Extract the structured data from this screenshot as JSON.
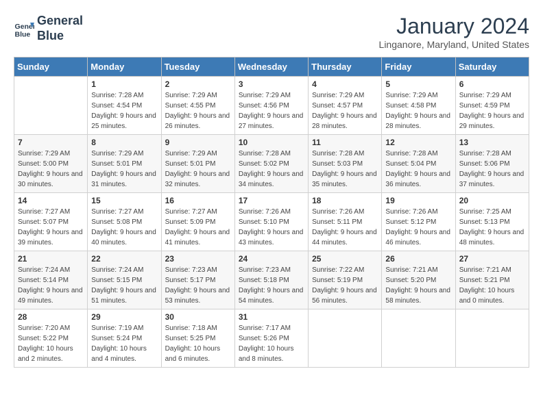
{
  "header": {
    "logo_line1": "General",
    "logo_line2": "Blue",
    "title": "January 2024",
    "subtitle": "Linganore, Maryland, United States"
  },
  "days_of_week": [
    "Sunday",
    "Monday",
    "Tuesday",
    "Wednesday",
    "Thursday",
    "Friday",
    "Saturday"
  ],
  "weeks": [
    [
      {
        "day": "",
        "sunrise": "",
        "sunset": "",
        "daylight": ""
      },
      {
        "day": "1",
        "sunrise": "Sunrise: 7:28 AM",
        "sunset": "Sunset: 4:54 PM",
        "daylight": "Daylight: 9 hours and 25 minutes."
      },
      {
        "day": "2",
        "sunrise": "Sunrise: 7:29 AM",
        "sunset": "Sunset: 4:55 PM",
        "daylight": "Daylight: 9 hours and 26 minutes."
      },
      {
        "day": "3",
        "sunrise": "Sunrise: 7:29 AM",
        "sunset": "Sunset: 4:56 PM",
        "daylight": "Daylight: 9 hours and 27 minutes."
      },
      {
        "day": "4",
        "sunrise": "Sunrise: 7:29 AM",
        "sunset": "Sunset: 4:57 PM",
        "daylight": "Daylight: 9 hours and 28 minutes."
      },
      {
        "day": "5",
        "sunrise": "Sunrise: 7:29 AM",
        "sunset": "Sunset: 4:58 PM",
        "daylight": "Daylight: 9 hours and 28 minutes."
      },
      {
        "day": "6",
        "sunrise": "Sunrise: 7:29 AM",
        "sunset": "Sunset: 4:59 PM",
        "daylight": "Daylight: 9 hours and 29 minutes."
      }
    ],
    [
      {
        "day": "7",
        "sunrise": "Sunrise: 7:29 AM",
        "sunset": "Sunset: 5:00 PM",
        "daylight": "Daylight: 9 hours and 30 minutes."
      },
      {
        "day": "8",
        "sunrise": "Sunrise: 7:29 AM",
        "sunset": "Sunset: 5:01 PM",
        "daylight": "Daylight: 9 hours and 31 minutes."
      },
      {
        "day": "9",
        "sunrise": "Sunrise: 7:29 AM",
        "sunset": "Sunset: 5:01 PM",
        "daylight": "Daylight: 9 hours and 32 minutes."
      },
      {
        "day": "10",
        "sunrise": "Sunrise: 7:28 AM",
        "sunset": "Sunset: 5:02 PM",
        "daylight": "Daylight: 9 hours and 34 minutes."
      },
      {
        "day": "11",
        "sunrise": "Sunrise: 7:28 AM",
        "sunset": "Sunset: 5:03 PM",
        "daylight": "Daylight: 9 hours and 35 minutes."
      },
      {
        "day": "12",
        "sunrise": "Sunrise: 7:28 AM",
        "sunset": "Sunset: 5:04 PM",
        "daylight": "Daylight: 9 hours and 36 minutes."
      },
      {
        "day": "13",
        "sunrise": "Sunrise: 7:28 AM",
        "sunset": "Sunset: 5:06 PM",
        "daylight": "Daylight: 9 hours and 37 minutes."
      }
    ],
    [
      {
        "day": "14",
        "sunrise": "Sunrise: 7:27 AM",
        "sunset": "Sunset: 5:07 PM",
        "daylight": "Daylight: 9 hours and 39 minutes."
      },
      {
        "day": "15",
        "sunrise": "Sunrise: 7:27 AM",
        "sunset": "Sunset: 5:08 PM",
        "daylight": "Daylight: 9 hours and 40 minutes."
      },
      {
        "day": "16",
        "sunrise": "Sunrise: 7:27 AM",
        "sunset": "Sunset: 5:09 PM",
        "daylight": "Daylight: 9 hours and 41 minutes."
      },
      {
        "day": "17",
        "sunrise": "Sunrise: 7:26 AM",
        "sunset": "Sunset: 5:10 PM",
        "daylight": "Daylight: 9 hours and 43 minutes."
      },
      {
        "day": "18",
        "sunrise": "Sunrise: 7:26 AM",
        "sunset": "Sunset: 5:11 PM",
        "daylight": "Daylight: 9 hours and 44 minutes."
      },
      {
        "day": "19",
        "sunrise": "Sunrise: 7:26 AM",
        "sunset": "Sunset: 5:12 PM",
        "daylight": "Daylight: 9 hours and 46 minutes."
      },
      {
        "day": "20",
        "sunrise": "Sunrise: 7:25 AM",
        "sunset": "Sunset: 5:13 PM",
        "daylight": "Daylight: 9 hours and 48 minutes."
      }
    ],
    [
      {
        "day": "21",
        "sunrise": "Sunrise: 7:24 AM",
        "sunset": "Sunset: 5:14 PM",
        "daylight": "Daylight: 9 hours and 49 minutes."
      },
      {
        "day": "22",
        "sunrise": "Sunrise: 7:24 AM",
        "sunset": "Sunset: 5:15 PM",
        "daylight": "Daylight: 9 hours and 51 minutes."
      },
      {
        "day": "23",
        "sunrise": "Sunrise: 7:23 AM",
        "sunset": "Sunset: 5:17 PM",
        "daylight": "Daylight: 9 hours and 53 minutes."
      },
      {
        "day": "24",
        "sunrise": "Sunrise: 7:23 AM",
        "sunset": "Sunset: 5:18 PM",
        "daylight": "Daylight: 9 hours and 54 minutes."
      },
      {
        "day": "25",
        "sunrise": "Sunrise: 7:22 AM",
        "sunset": "Sunset: 5:19 PM",
        "daylight": "Daylight: 9 hours and 56 minutes."
      },
      {
        "day": "26",
        "sunrise": "Sunrise: 7:21 AM",
        "sunset": "Sunset: 5:20 PM",
        "daylight": "Daylight: 9 hours and 58 minutes."
      },
      {
        "day": "27",
        "sunrise": "Sunrise: 7:21 AM",
        "sunset": "Sunset: 5:21 PM",
        "daylight": "Daylight: 10 hours and 0 minutes."
      }
    ],
    [
      {
        "day": "28",
        "sunrise": "Sunrise: 7:20 AM",
        "sunset": "Sunset: 5:22 PM",
        "daylight": "Daylight: 10 hours and 2 minutes."
      },
      {
        "day": "29",
        "sunrise": "Sunrise: 7:19 AM",
        "sunset": "Sunset: 5:24 PM",
        "daylight": "Daylight: 10 hours and 4 minutes."
      },
      {
        "day": "30",
        "sunrise": "Sunrise: 7:18 AM",
        "sunset": "Sunset: 5:25 PM",
        "daylight": "Daylight: 10 hours and 6 minutes."
      },
      {
        "day": "31",
        "sunrise": "Sunrise: 7:17 AM",
        "sunset": "Sunset: 5:26 PM",
        "daylight": "Daylight: 10 hours and 8 minutes."
      },
      {
        "day": "",
        "sunrise": "",
        "sunset": "",
        "daylight": ""
      },
      {
        "day": "",
        "sunrise": "",
        "sunset": "",
        "daylight": ""
      },
      {
        "day": "",
        "sunrise": "",
        "sunset": "",
        "daylight": ""
      }
    ]
  ]
}
